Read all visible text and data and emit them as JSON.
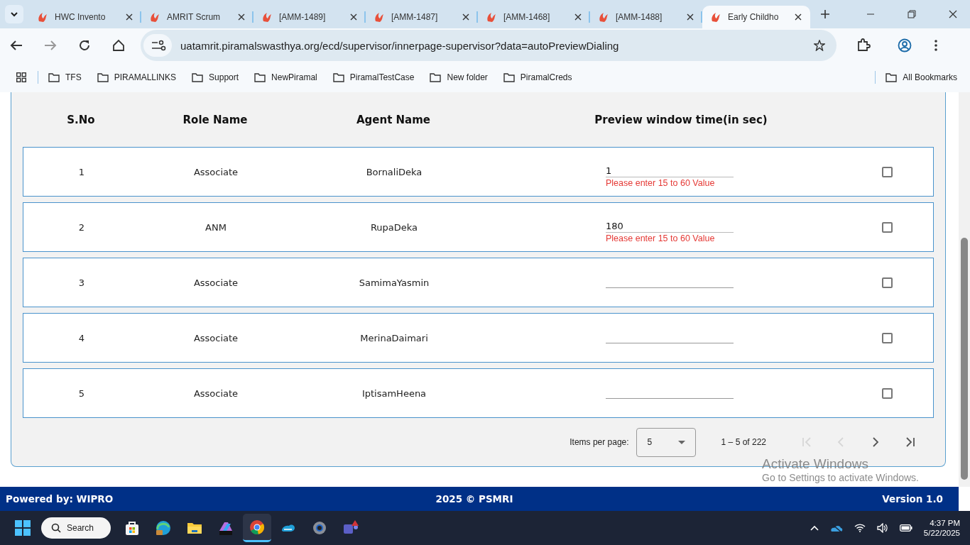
{
  "browser": {
    "tabs": [
      {
        "title": "HWC Invento",
        "selected": false
      },
      {
        "title": "AMRIT Scrum",
        "selected": false
      },
      {
        "title": "[AMM-1489]",
        "selected": false
      },
      {
        "title": "[AMM-1487]",
        "selected": false
      },
      {
        "title": "[AMM-1468]",
        "selected": false
      },
      {
        "title": "[AMM-1488]",
        "selected": false
      },
      {
        "title": "Early Childho",
        "selected": true
      }
    ],
    "address": "uatamrit.piramalswasthya.org/ecd/supervisor/innerpage-supervisor?data=autoPreviewDialing",
    "bookmarks": [
      "TFS",
      "PIRAMALLINKS",
      "Support",
      "NewPiramal",
      "PiramalTestCase",
      "New folder",
      "PiramalCreds"
    ],
    "all_bookmarks": "All Bookmarks"
  },
  "table": {
    "columns": [
      "S.No",
      "Role Name",
      "Agent Name",
      "Preview window time(in sec)"
    ],
    "rows": [
      {
        "sno": "1",
        "role": "Associate",
        "agent": "BornaliDeka",
        "value": "1",
        "error": "Please enter 15 to 60 Value",
        "checked": false
      },
      {
        "sno": "2",
        "role": "ANM",
        "agent": "RupaDeka",
        "value": "180",
        "error": "Please enter 15 to 60 Value",
        "checked": false
      },
      {
        "sno": "3",
        "role": "Associate",
        "agent": "SamimaYasmin",
        "checked": false
      },
      {
        "sno": "4",
        "role": "Associate",
        "agent": "MerinaDaimari",
        "checked": false
      },
      {
        "sno": "5",
        "role": "Associate",
        "agent": "IptisamHeena",
        "checked": false
      }
    ]
  },
  "paginator": {
    "label": "Items per page:",
    "page_size": "5",
    "range": "1 – 5 of 222",
    "buttons": [
      {
        "kind": "first",
        "disabled": true
      },
      {
        "kind": "prev",
        "disabled": true
      },
      {
        "kind": "next",
        "disabled": false
      },
      {
        "kind": "last",
        "disabled": false
      }
    ]
  },
  "footer": {
    "left": "Powered by: WIPRO",
    "center": "2025 © PSMRI",
    "right": "Version 1.0"
  },
  "os_overlay": {
    "title": "Activate Windows",
    "subtitle": "Go to Settings to activate Windows."
  },
  "taskbar": {
    "search": "Search",
    "apps": [
      {
        "kind": "store",
        "selected": false
      },
      {
        "kind": "edge",
        "selected": false
      },
      {
        "kind": "files",
        "selected": false
      },
      {
        "kind": "m365",
        "selected": false
      },
      {
        "kind": "chrome",
        "selected": true
      },
      {
        "kind": "cloud",
        "selected": false
      },
      {
        "kind": "settings",
        "selected": false
      },
      {
        "kind": "teams",
        "selected": false
      }
    ],
    "time": "4:37 PM",
    "date": "5/22/2025"
  }
}
